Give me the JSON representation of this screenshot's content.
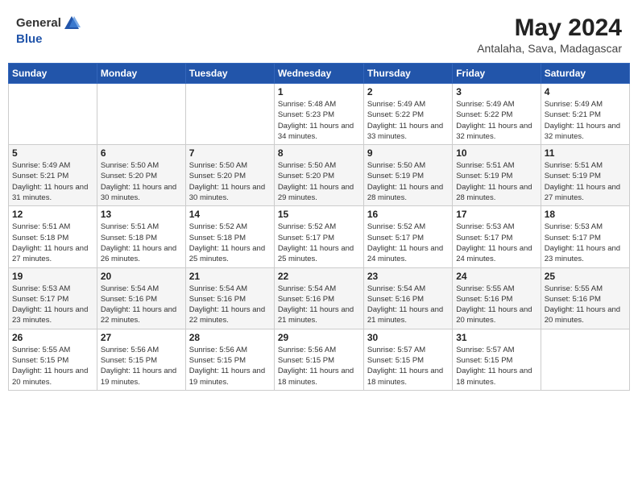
{
  "header": {
    "logo_general": "General",
    "logo_blue": "Blue",
    "month_year": "May 2024",
    "location": "Antalaha, Sava, Madagascar"
  },
  "days_of_week": [
    "Sunday",
    "Monday",
    "Tuesday",
    "Wednesday",
    "Thursday",
    "Friday",
    "Saturday"
  ],
  "weeks": [
    [
      {
        "day": "",
        "sunrise": "",
        "sunset": "",
        "daylight": ""
      },
      {
        "day": "",
        "sunrise": "",
        "sunset": "",
        "daylight": ""
      },
      {
        "day": "",
        "sunrise": "",
        "sunset": "",
        "daylight": ""
      },
      {
        "day": "1",
        "sunrise": "Sunrise: 5:48 AM",
        "sunset": "Sunset: 5:23 PM",
        "daylight": "Daylight: 11 hours and 34 minutes."
      },
      {
        "day": "2",
        "sunrise": "Sunrise: 5:49 AM",
        "sunset": "Sunset: 5:22 PM",
        "daylight": "Daylight: 11 hours and 33 minutes."
      },
      {
        "day": "3",
        "sunrise": "Sunrise: 5:49 AM",
        "sunset": "Sunset: 5:22 PM",
        "daylight": "Daylight: 11 hours and 32 minutes."
      },
      {
        "day": "4",
        "sunrise": "Sunrise: 5:49 AM",
        "sunset": "Sunset: 5:21 PM",
        "daylight": "Daylight: 11 hours and 32 minutes."
      }
    ],
    [
      {
        "day": "5",
        "sunrise": "Sunrise: 5:49 AM",
        "sunset": "Sunset: 5:21 PM",
        "daylight": "Daylight: 11 hours and 31 minutes."
      },
      {
        "day": "6",
        "sunrise": "Sunrise: 5:50 AM",
        "sunset": "Sunset: 5:20 PM",
        "daylight": "Daylight: 11 hours and 30 minutes."
      },
      {
        "day": "7",
        "sunrise": "Sunrise: 5:50 AM",
        "sunset": "Sunset: 5:20 PM",
        "daylight": "Daylight: 11 hours and 30 minutes."
      },
      {
        "day": "8",
        "sunrise": "Sunrise: 5:50 AM",
        "sunset": "Sunset: 5:20 PM",
        "daylight": "Daylight: 11 hours and 29 minutes."
      },
      {
        "day": "9",
        "sunrise": "Sunrise: 5:50 AM",
        "sunset": "Sunset: 5:19 PM",
        "daylight": "Daylight: 11 hours and 28 minutes."
      },
      {
        "day": "10",
        "sunrise": "Sunrise: 5:51 AM",
        "sunset": "Sunset: 5:19 PM",
        "daylight": "Daylight: 11 hours and 28 minutes."
      },
      {
        "day": "11",
        "sunrise": "Sunrise: 5:51 AM",
        "sunset": "Sunset: 5:19 PM",
        "daylight": "Daylight: 11 hours and 27 minutes."
      }
    ],
    [
      {
        "day": "12",
        "sunrise": "Sunrise: 5:51 AM",
        "sunset": "Sunset: 5:18 PM",
        "daylight": "Daylight: 11 hours and 27 minutes."
      },
      {
        "day": "13",
        "sunrise": "Sunrise: 5:51 AM",
        "sunset": "Sunset: 5:18 PM",
        "daylight": "Daylight: 11 hours and 26 minutes."
      },
      {
        "day": "14",
        "sunrise": "Sunrise: 5:52 AM",
        "sunset": "Sunset: 5:18 PM",
        "daylight": "Daylight: 11 hours and 25 minutes."
      },
      {
        "day": "15",
        "sunrise": "Sunrise: 5:52 AM",
        "sunset": "Sunset: 5:17 PM",
        "daylight": "Daylight: 11 hours and 25 minutes."
      },
      {
        "day": "16",
        "sunrise": "Sunrise: 5:52 AM",
        "sunset": "Sunset: 5:17 PM",
        "daylight": "Daylight: 11 hours and 24 minutes."
      },
      {
        "day": "17",
        "sunrise": "Sunrise: 5:53 AM",
        "sunset": "Sunset: 5:17 PM",
        "daylight": "Daylight: 11 hours and 24 minutes."
      },
      {
        "day": "18",
        "sunrise": "Sunrise: 5:53 AM",
        "sunset": "Sunset: 5:17 PM",
        "daylight": "Daylight: 11 hours and 23 minutes."
      }
    ],
    [
      {
        "day": "19",
        "sunrise": "Sunrise: 5:53 AM",
        "sunset": "Sunset: 5:17 PM",
        "daylight": "Daylight: 11 hours and 23 minutes."
      },
      {
        "day": "20",
        "sunrise": "Sunrise: 5:54 AM",
        "sunset": "Sunset: 5:16 PM",
        "daylight": "Daylight: 11 hours and 22 minutes."
      },
      {
        "day": "21",
        "sunrise": "Sunrise: 5:54 AM",
        "sunset": "Sunset: 5:16 PM",
        "daylight": "Daylight: 11 hours and 22 minutes."
      },
      {
        "day": "22",
        "sunrise": "Sunrise: 5:54 AM",
        "sunset": "Sunset: 5:16 PM",
        "daylight": "Daylight: 11 hours and 21 minutes."
      },
      {
        "day": "23",
        "sunrise": "Sunrise: 5:54 AM",
        "sunset": "Sunset: 5:16 PM",
        "daylight": "Daylight: 11 hours and 21 minutes."
      },
      {
        "day": "24",
        "sunrise": "Sunrise: 5:55 AM",
        "sunset": "Sunset: 5:16 PM",
        "daylight": "Daylight: 11 hours and 20 minutes."
      },
      {
        "day": "25",
        "sunrise": "Sunrise: 5:55 AM",
        "sunset": "Sunset: 5:16 PM",
        "daylight": "Daylight: 11 hours and 20 minutes."
      }
    ],
    [
      {
        "day": "26",
        "sunrise": "Sunrise: 5:55 AM",
        "sunset": "Sunset: 5:15 PM",
        "daylight": "Daylight: 11 hours and 20 minutes."
      },
      {
        "day": "27",
        "sunrise": "Sunrise: 5:56 AM",
        "sunset": "Sunset: 5:15 PM",
        "daylight": "Daylight: 11 hours and 19 minutes."
      },
      {
        "day": "28",
        "sunrise": "Sunrise: 5:56 AM",
        "sunset": "Sunset: 5:15 PM",
        "daylight": "Daylight: 11 hours and 19 minutes."
      },
      {
        "day": "29",
        "sunrise": "Sunrise: 5:56 AM",
        "sunset": "Sunset: 5:15 PM",
        "daylight": "Daylight: 11 hours and 18 minutes."
      },
      {
        "day": "30",
        "sunrise": "Sunrise: 5:57 AM",
        "sunset": "Sunset: 5:15 PM",
        "daylight": "Daylight: 11 hours and 18 minutes."
      },
      {
        "day": "31",
        "sunrise": "Sunrise: 5:57 AM",
        "sunset": "Sunset: 5:15 PM",
        "daylight": "Daylight: 11 hours and 18 minutes."
      },
      {
        "day": "",
        "sunrise": "",
        "sunset": "",
        "daylight": ""
      }
    ]
  ]
}
